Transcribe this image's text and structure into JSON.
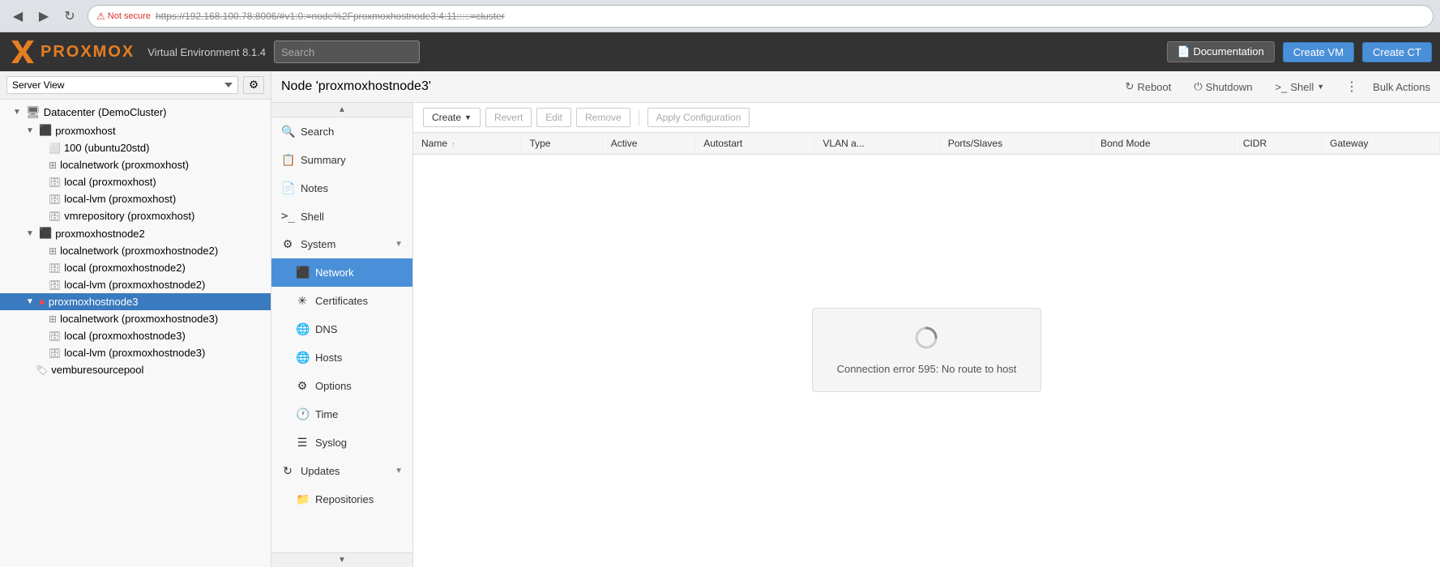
{
  "browser": {
    "back_icon": "◀",
    "forward_icon": "▶",
    "reload_icon": "↻",
    "not_secure_label": "Not secure",
    "url": "https://192.168.100.78:8006/#v1:0:=node%2Fproxmoxhostnode3:4:11:::::=cluster"
  },
  "header": {
    "logo_text": "PROXMOX",
    "version": "Virtual Environment 8.1.4",
    "search_placeholder": "Search",
    "doc_btn": "Documentation",
    "create_vm_btn": "Create VM",
    "create_ct_btn": "Create CT"
  },
  "sidebar": {
    "server_view_label": "Server View",
    "tree": [
      {
        "id": "dc",
        "label": "Datacenter (DemoCluster)",
        "indent": 1,
        "type": "datacenter",
        "expanded": true
      },
      {
        "id": "proxmoxhost",
        "label": "proxmoxhost",
        "indent": 2,
        "type": "node-ok",
        "expanded": true
      },
      {
        "id": "100",
        "label": "100 (ubuntu20std)",
        "indent": 3,
        "type": "vm"
      },
      {
        "id": "localnetwork-pmh",
        "label": "localnetwork (proxmoxhost)",
        "indent": 3,
        "type": "network"
      },
      {
        "id": "local-pmh",
        "label": "local (proxmoxhost)",
        "indent": 3,
        "type": "storage"
      },
      {
        "id": "local-lvm-pmh",
        "label": "local-lvm (proxmoxhost)",
        "indent": 3,
        "type": "storage"
      },
      {
        "id": "vmrepo-pmh",
        "label": "vmrepository (proxmoxhost)",
        "indent": 3,
        "type": "storage"
      },
      {
        "id": "proxmoxhostnode2",
        "label": "proxmoxhostnode2",
        "indent": 2,
        "type": "node-ok",
        "expanded": true
      },
      {
        "id": "localnetwork-pmh2",
        "label": "localnetwork (proxmoxhostnode2)",
        "indent": 3,
        "type": "network"
      },
      {
        "id": "local-pmh2",
        "label": "local (proxmoxhostnode2)",
        "indent": 3,
        "type": "storage"
      },
      {
        "id": "local-lvm-pmh2",
        "label": "local-lvm (proxmoxhostnode2)",
        "indent": 3,
        "type": "storage"
      },
      {
        "id": "proxmoxhostnode3",
        "label": "proxmoxhostnode3",
        "indent": 2,
        "type": "node-error",
        "expanded": true,
        "selected": true
      },
      {
        "id": "localnetwork-pmh3",
        "label": "localnetwork (proxmoxhostnode3)",
        "indent": 3,
        "type": "network"
      },
      {
        "id": "local-pmh3",
        "label": "local (proxmoxhostnode3)",
        "indent": 3,
        "type": "storage"
      },
      {
        "id": "local-lvm-pmh3",
        "label": "local-lvm (proxmoxhostnode3)",
        "indent": 3,
        "type": "storage"
      },
      {
        "id": "vemburepool",
        "label": "vemburesourcepool",
        "indent": 2,
        "type": "pool"
      }
    ]
  },
  "node_header": {
    "title": "Node 'proxmoxhostnode3'",
    "reboot_btn": "Reboot",
    "shutdown_btn": "Shutdown",
    "shell_btn": "Shell",
    "bulk_actions_label": "Bulk Actions"
  },
  "nav_menu": {
    "scroll_up": "▲",
    "scroll_down": "▼",
    "items": [
      {
        "id": "search",
        "label": "Search",
        "icon": "🔍",
        "active": false
      },
      {
        "id": "summary",
        "label": "Summary",
        "icon": "📋",
        "active": false
      },
      {
        "id": "notes",
        "label": "Notes",
        "icon": "📄",
        "active": false
      },
      {
        "id": "shell",
        "label": "Shell",
        "icon": ">_",
        "active": false
      },
      {
        "id": "system",
        "label": "System",
        "icon": "⚙",
        "active": false,
        "section": true
      },
      {
        "id": "network",
        "label": "Network",
        "icon": "⬛",
        "active": true,
        "sub": true
      },
      {
        "id": "certificates",
        "label": "Certificates",
        "icon": "✳",
        "active": false,
        "sub": true
      },
      {
        "id": "dns",
        "label": "DNS",
        "icon": "🌐",
        "active": false,
        "sub": true
      },
      {
        "id": "hosts",
        "label": "Hosts",
        "icon": "🌐",
        "active": false,
        "sub": true
      },
      {
        "id": "options",
        "label": "Options",
        "icon": "⚙",
        "active": false,
        "sub": true
      },
      {
        "id": "time",
        "label": "Time",
        "icon": "🕐",
        "active": false,
        "sub": true
      },
      {
        "id": "syslog",
        "label": "Syslog",
        "icon": "☰",
        "active": false,
        "sub": true
      },
      {
        "id": "updates",
        "label": "Updates",
        "icon": "↻",
        "active": false,
        "section": true
      },
      {
        "id": "repositories",
        "label": "Repositories",
        "icon": "📁",
        "active": false,
        "sub": true
      }
    ]
  },
  "toolbar": {
    "create_btn": "Create",
    "revert_btn": "Revert",
    "edit_btn": "Edit",
    "remove_btn": "Remove",
    "apply_config_btn": "Apply Configuration"
  },
  "table": {
    "columns": [
      {
        "id": "name",
        "label": "Name",
        "sortable": true
      },
      {
        "id": "type",
        "label": "Type"
      },
      {
        "id": "active",
        "label": "Active"
      },
      {
        "id": "autostart",
        "label": "Autostart"
      },
      {
        "id": "vlan_aware",
        "label": "VLAN a..."
      },
      {
        "id": "ports_slaves",
        "label": "Ports/Slaves"
      },
      {
        "id": "bond_mode",
        "label": "Bond Mode"
      },
      {
        "id": "cidr",
        "label": "CIDR"
      },
      {
        "id": "gateway",
        "label": "Gateway"
      }
    ],
    "rows": []
  },
  "error": {
    "spinner_icon": "⌛",
    "message": "Connection error 595: No route to host"
  }
}
